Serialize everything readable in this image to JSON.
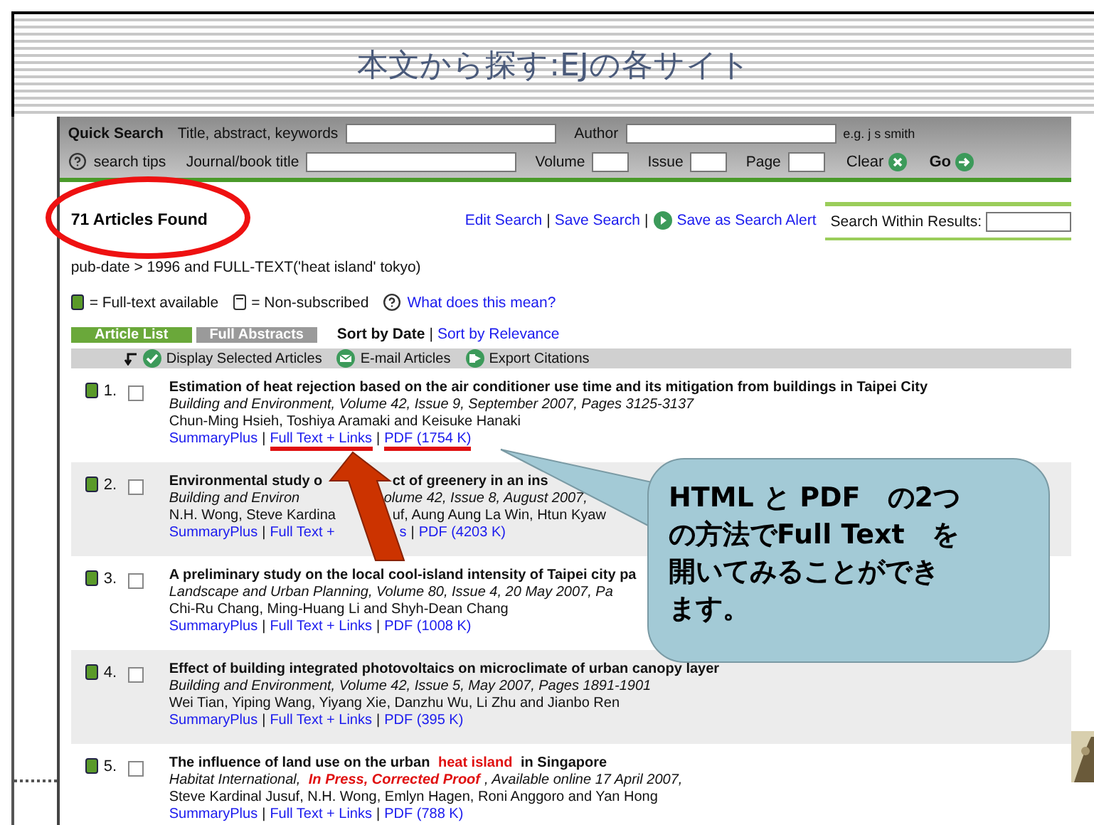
{
  "slide": {
    "title": "本文から探す:EJの各サイト"
  },
  "quick_search": {
    "title": "Quick Search",
    "help": "search tips",
    "top_fields": [
      {
        "label": "Title, abstract, keywords"
      },
      {
        "label": "Author"
      }
    ],
    "bottom_fields": [
      {
        "label": "Journal/book title"
      },
      {
        "label": "Volume"
      },
      {
        "label": "Issue"
      },
      {
        "label": "Page"
      }
    ],
    "hint": "e.g. j s smith",
    "buttons": [
      {
        "label": "Clear",
        "kind": "clear"
      },
      {
        "label": "Go",
        "kind": "go"
      }
    ]
  },
  "results": {
    "count": "71 Articles Found",
    "circled": true,
    "actions": [
      {
        "text": "Edit Search",
        "kind": "link"
      },
      {
        "text": "|",
        "kind": "separator"
      },
      {
        "text": "Save Search",
        "kind": "link"
      },
      {
        "text": "|",
        "kind": "separator"
      },
      {
        "text": "Save as Search Alert",
        "kind": "alert"
      }
    ],
    "search_within": "Search Within Results:",
    "query": "pub-date > 1996 and FULL-TEXT('heat island' tokyo)",
    "legend": [
      {
        "kind": "full",
        "text": "= Full-text available"
      },
      {
        "kind": "none",
        "text": "= Non-subscribed"
      }
    ],
    "legend_help": "What does this mean?",
    "tabs": [
      {
        "label": "Article List",
        "selected": true
      },
      {
        "label": "Full Abstracts",
        "selected": false
      }
    ],
    "sort": [
      {
        "text": "Sort by Date",
        "kind": "option",
        "selected": true
      },
      {
        "text": "|",
        "kind": "separator"
      },
      {
        "text": "Sort by Relevance",
        "kind": "option",
        "selected": false
      }
    ],
    "toolbar": [
      {
        "label": "Display Selected Articles",
        "kind": "check"
      },
      {
        "label": "E-mail Articles",
        "kind": "mail"
      },
      {
        "label": "Export Citations",
        "kind": "export"
      }
    ]
  },
  "articles": [
    {
      "number": "1.",
      "full_text": true,
      "checked": false,
      "title": [
        {
          "text": "Estimation of heat rejection based on the air conditioner use time and its mitigation from buildings in Taipei City"
        }
      ],
      "source": [
        {
          "text": "Building and Environment, Volume 42, Issue 9, September 2007, Pages 3125-3137"
        }
      ],
      "authors": [
        {
          "text": "Chun-Ming Hsieh, Toshiya Aramaki and Keisuke Hanaki"
        }
      ],
      "links": [
        {
          "text": "SummaryPlus",
          "kind": "link",
          "underlined": false
        },
        {
          "text": "|",
          "kind": "separator"
        },
        {
          "text": "Full Text + Links",
          "kind": "link",
          "underlined": true
        },
        {
          "text": "|",
          "kind": "separator"
        },
        {
          "text": "PDF (1754 K)",
          "kind": "link",
          "underlined": true
        }
      ]
    },
    {
      "number": "2.",
      "full_text": true,
      "checked": false,
      "title": [
        {
          "text": "Environmental study o",
          "gap": true
        },
        {
          "text": "ct of greenery in an ins"
        }
      ],
      "source": [
        {
          "text": "Building and Environ",
          "gap": true
        },
        {
          "text": "olume 42, Issue 8, August 2007,"
        }
      ],
      "authors": [
        {
          "text": "N.H. Wong, Steve Kardina",
          "gap": true
        },
        {
          "text": "uf, Aung Aung La Win, Htun Kyaw"
        }
      ],
      "links": [
        {
          "text": "SummaryPlus",
          "kind": "link",
          "underlined": false
        },
        {
          "text": "|",
          "kind": "separator"
        },
        {
          "text": "Full Text +",
          "kind": "link",
          "underlined": false,
          "gap": true
        },
        {
          "text": "s",
          "kind": "link",
          "underlined": false
        },
        {
          "text": "|",
          "kind": "separator"
        },
        {
          "text": "PDF (4203 K)",
          "kind": "link",
          "underlined": false
        }
      ]
    },
    {
      "number": "3.",
      "full_text": true,
      "checked": false,
      "title": [
        {
          "text": "A preliminary study on the local cool-island intensity of Taipei city pa"
        }
      ],
      "source": [
        {
          "text": "Landscape and Urban Planning, Volume 80, Issue 4, 20 May 2007, Pa"
        }
      ],
      "authors": [
        {
          "text": "Chi-Ru Chang, Ming-Huang Li and Shyh-Dean Chang"
        }
      ],
      "links": [
        {
          "text": "SummaryPlus",
          "kind": "link",
          "underlined": false
        },
        {
          "text": "|",
          "kind": "separator"
        },
        {
          "text": "Full Text + Links",
          "kind": "link",
          "underlined": false
        },
        {
          "text": "|",
          "kind": "separator"
        },
        {
          "text": "PDF (1008 K)",
          "kind": "link",
          "underlined": false
        }
      ]
    },
    {
      "number": "4.",
      "full_text": true,
      "checked": false,
      "title": [
        {
          "text": "Effect of building integrated photovoltaics on microclimate of urban canopy layer"
        }
      ],
      "source": [
        {
          "text": "Building and Environment, Volume 42, Issue 5, May 2007, Pages 1891-1901"
        }
      ],
      "authors": [
        {
          "text": "Wei Tian, Yiping Wang, Yiyang Xie, Danzhu Wu, Li Zhu and Jianbo Ren"
        }
      ],
      "links": [
        {
          "text": "SummaryPlus",
          "kind": "link",
          "underlined": false
        },
        {
          "text": "|",
          "kind": "separator"
        },
        {
          "text": "Full Text + Links",
          "kind": "link",
          "underlined": false
        },
        {
          "text": "|",
          "kind": "separator"
        },
        {
          "text": "PDF (395 K)",
          "kind": "link",
          "underlined": false
        }
      ]
    },
    {
      "number": "5.",
      "full_text": true,
      "checked": false,
      "title": [
        {
          "text": "The influence of land use on the urban "
        },
        {
          "text": "heat island",
          "highlight": true
        },
        {
          "text": " in Singapore"
        }
      ],
      "source": [
        {
          "text": "Habitat International, "
        },
        {
          "text": "In Press, Corrected Proof",
          "highlight": true
        },
        {
          "text": ", Available online 17 April 2007,"
        }
      ],
      "authors": [
        {
          "text": "Steve Kardinal Jusuf, N.H. Wong, Emlyn Hagen, Roni Anggoro and Yan Hong"
        }
      ],
      "links": [
        {
          "text": "SummaryPlus",
          "kind": "link",
          "underlined": false
        },
        {
          "text": "|",
          "kind": "separator"
        },
        {
          "text": "Full Text + Links",
          "kind": "link",
          "underlined": false
        },
        {
          "text": "|",
          "kind": "separator"
        },
        {
          "text": "PDF (788 K)",
          "kind": "link",
          "underlined": false
        }
      ]
    }
  ],
  "callout": {
    "lines": [
      "HTML と PDF　の2つ",
      "の方法でFull Text　を",
      "開いてみることができ",
      "ます。"
    ],
    "pointer_arrow": true
  }
}
